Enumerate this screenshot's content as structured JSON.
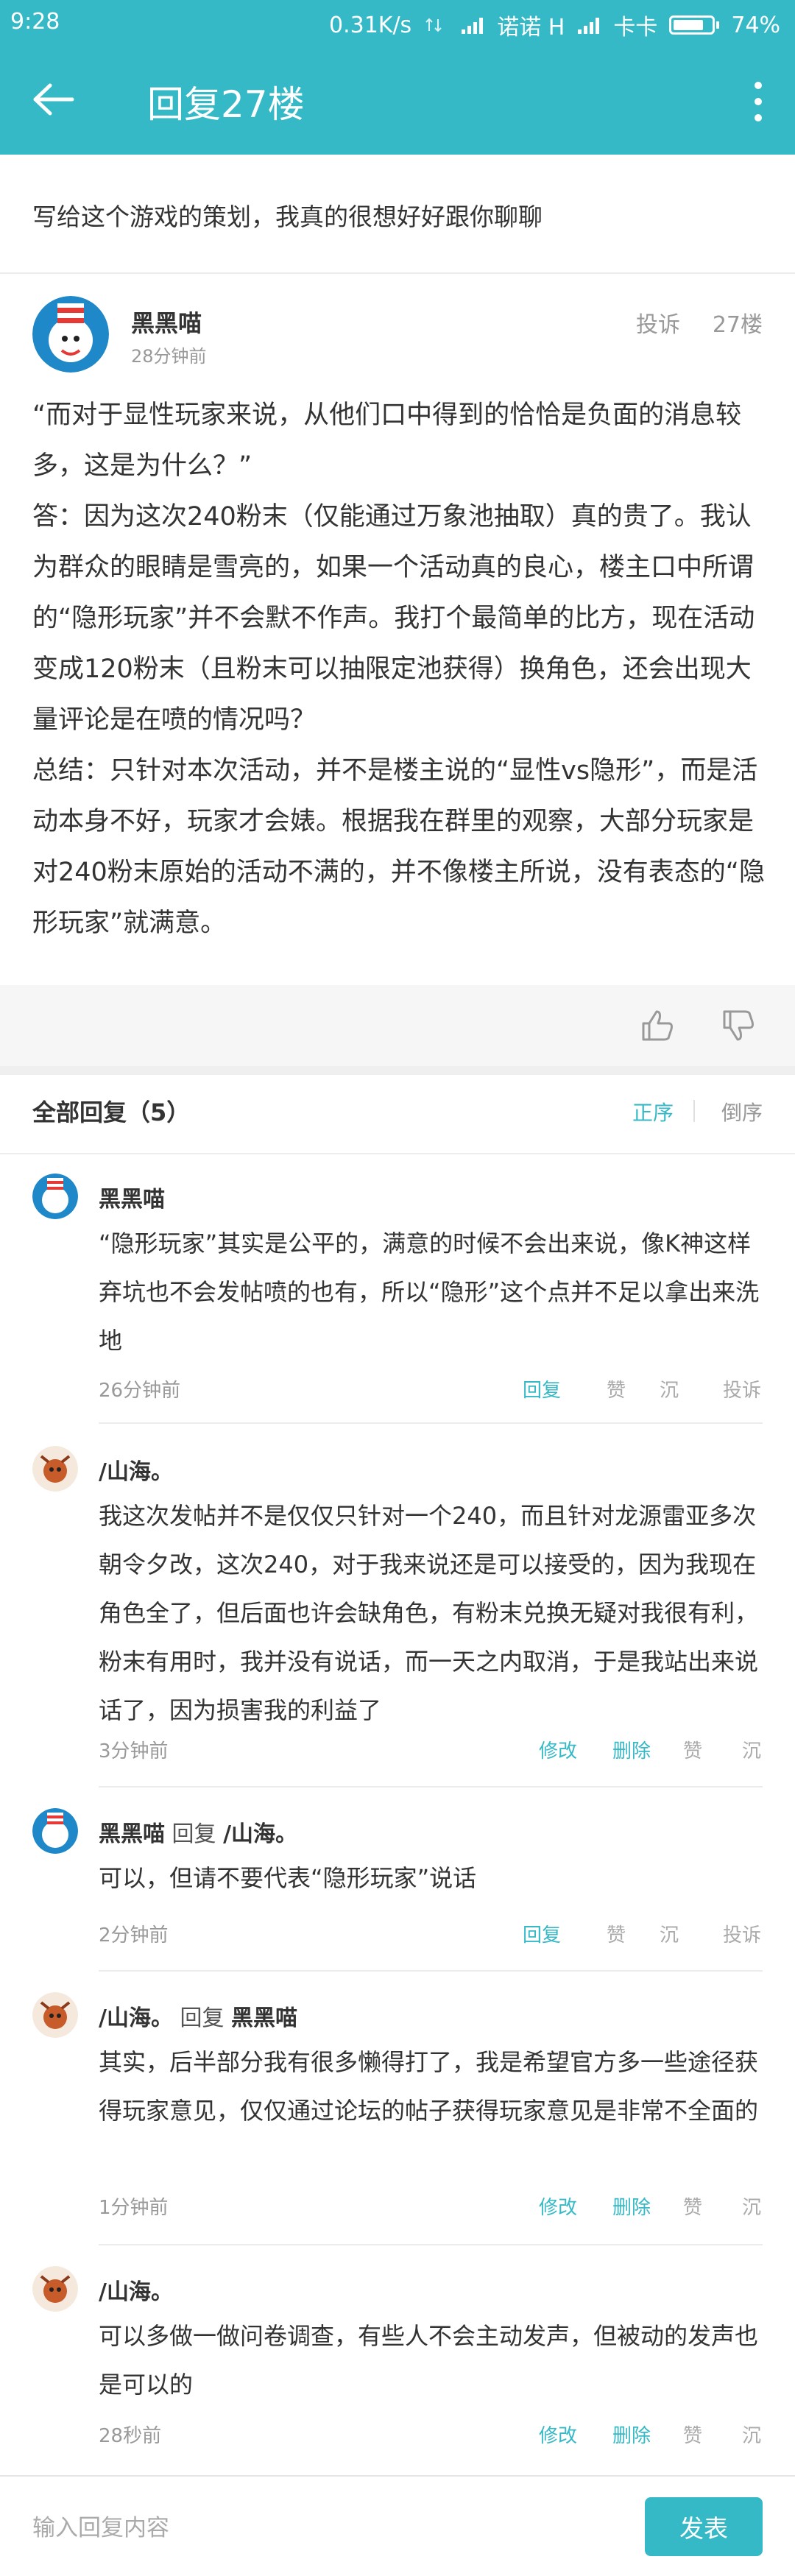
{
  "status_bar": {
    "time": "9:28",
    "speed": "0.31K/s",
    "carrier1": "诺诺 H",
    "carrier2": "卡卡",
    "battery": "74%"
  },
  "app_bar": {
    "title": "回复27楼"
  },
  "thread_title": "写给这个游戏的策划，我真的很想好好跟你聊聊",
  "post": {
    "author": "黑黑喵",
    "time": "28分钟前",
    "report": "投诉",
    "floor": "27楼",
    "paragraphs": [
      "“而对于显性玩家来说，从他们口中得到的恰恰是负面的消息较多，这是为什么？”",
      "答：因为这次240粉末（仅能通过万象池抽取）真的贵了。我认为群众的眼睛是雪亮的，如果一个活动真的良心，楼主口中所谓的“隐形玩家”并不会默不作声。我打个最简单的比方，现在活动变成120粉末（且粉末可以抽限定池获得）换角色，还会出现大量评论是在喷的情况吗？",
      "总结：只针对本次活动，并不是楼主说的“显性vs隐形”，而是活动本身不好，玩家才会婊。根据我在群里的观察，大部分玩家是对240粉末原始的活动不满的，并不像楼主所说，没有表态的“隐形玩家”就满意。"
    ]
  },
  "replies_header": {
    "label": "全部回复（5）",
    "sort_asc": "正序",
    "sort_desc": "倒序"
  },
  "replies": [
    {
      "author": "黑黑喵",
      "mid": "",
      "target": "",
      "body": "“隐形玩家”其实是公平的，满意的时候不会出来说，像K神这样弃坑也不会发帖喷的也有，所以“隐形”这个点并不足以拿出来洗地",
      "time": "26分钟前",
      "actions": [
        "回复",
        "赞",
        "沉",
        "投诉"
      ]
    },
    {
      "author": "/山海。",
      "mid": "",
      "target": "",
      "body": "我这次发帖并不是仅仅只针对一个240，而且针对龙源雷亚多次朝令夕改，这次240，对于我来说还是可以接受的，因为我现在角色全了，但后面也许会缺角色，有粉末兑换无疑对我很有利，粉末有用时，我并没有说话，而一天之内取消，于是我站出来说话了，因为损害我的利益了",
      "time": "3分钟前",
      "actions": [
        "修改",
        "删除",
        "赞",
        "沉"
      ]
    },
    {
      "author": "黑黑喵",
      "mid": " 回复 ",
      "target": "/山海。",
      "body": "可以，但请不要代表“隐形玩家”说话",
      "time": "2分钟前",
      "actions": [
        "回复",
        "赞",
        "沉",
        "投诉"
      ]
    },
    {
      "author": "/山海。",
      "mid": " 回复 ",
      "target": "黑黑喵",
      "body": "其实，后半部分我有很多懒得打了，我是希望官方多一些途径获得玩家意见，仅仅通过论坛的帖子获得玩家意见是非常不全面的",
      "time": "1分钟前",
      "actions": [
        "修改",
        "删除",
        "赞",
        "沉"
      ]
    },
    {
      "author": "/山海。",
      "mid": "",
      "target": "",
      "body": "可以多做一做问卷调查，有些人不会主动发声，但被动的发声也是可以的",
      "time": "28秒前",
      "actions": [
        "修改",
        "删除",
        "赞",
        "沉"
      ]
    }
  ],
  "input_bar": {
    "placeholder": "输入回复内容",
    "send": "发表"
  },
  "colors": {
    "accent": "#36b9c6",
    "text": "#333333",
    "muted": "#999999"
  }
}
